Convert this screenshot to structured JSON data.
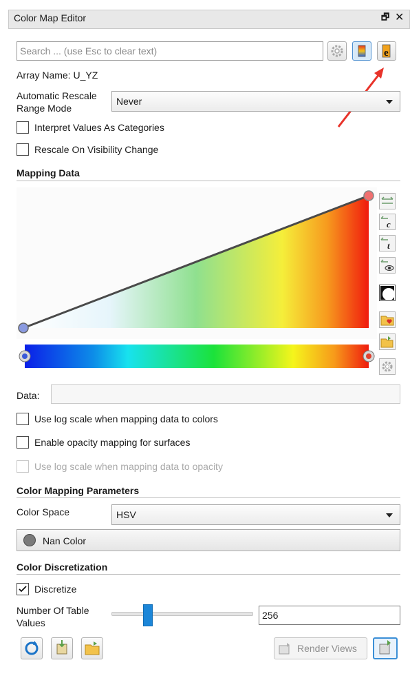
{
  "panel": {
    "title": "Color Map Editor"
  },
  "search": {
    "placeholder": "Search ... (use Esc to clear text)"
  },
  "array_name": "Array Name: U_YZ",
  "rescale": {
    "label_line1": "Automatic Rescale",
    "label_line2": "Range Mode",
    "value": "Never"
  },
  "checkboxes": {
    "interpret_categories": {
      "label": "Interpret Values As Categories",
      "checked": false
    },
    "rescale_visibility": {
      "label": "Rescale On Visibility Change",
      "checked": false
    },
    "log_colors": {
      "label": "Use log scale when mapping data to colors",
      "checked": false
    },
    "opacity_mapping": {
      "label": "Enable opacity mapping for surfaces",
      "checked": false
    },
    "log_opacity": {
      "label": "Use log scale when mapping data to opacity",
      "checked": false,
      "disabled": true
    },
    "discretize": {
      "label": "Discretize",
      "checked": true
    }
  },
  "mapping": {
    "section": "Mapping Data",
    "data_label": "Data:"
  },
  "color_params": {
    "section": "Color Mapping Parameters",
    "color_space_label": "Color Space",
    "color_space_value": "HSV",
    "nan_color_label": "Nan Color"
  },
  "discretization": {
    "section": "Color Discretization",
    "table_values_line1": "Number Of Table",
    "table_values_line2": "Values",
    "table_values": "256",
    "slider_fraction": 0.25
  },
  "buttons": {
    "render_views": "Render Views"
  },
  "colors": {
    "accent": "#1c86d8",
    "annotation_arrow": "#e8332a"
  }
}
